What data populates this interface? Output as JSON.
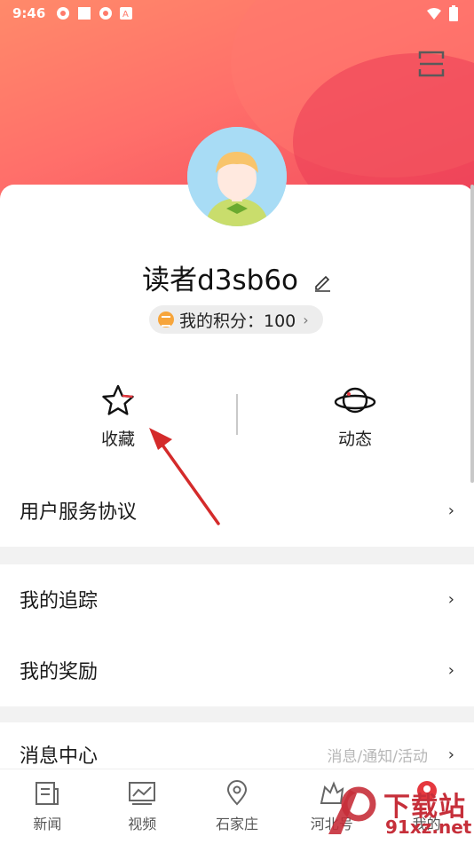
{
  "status_bar": {
    "time": "9:46"
  },
  "profile": {
    "username": "读者d3sb6o",
    "points_label": "我的积分：100",
    "chevron": "›"
  },
  "quick_actions": [
    {
      "label": "收藏",
      "icon": "star-icon"
    },
    {
      "label": "动态",
      "icon": "planet-icon"
    }
  ],
  "menu": {
    "user_agreement": "用户服务协议",
    "my_tracking": "我的追踪",
    "my_rewards": "我的奖励",
    "message_center": "消息中心",
    "message_hint": "消息/通知/活动",
    "chevron": "›"
  },
  "tabs": [
    {
      "label": "新闻",
      "icon": "newspaper-icon"
    },
    {
      "label": "视频",
      "icon": "video-icon"
    },
    {
      "label": "石家庄",
      "icon": "location-icon"
    },
    {
      "label": "河北号",
      "icon": "hebei-icon"
    },
    {
      "label": "我的",
      "icon": "profile-icon"
    }
  ],
  "watermark": {
    "line1": "下载站",
    "line2": "91xz.net"
  },
  "colors": {
    "header_start": "#ff8a6a",
    "header_end": "#f0475b",
    "accent": "#e5383f",
    "arrow": "#d42b2b"
  }
}
